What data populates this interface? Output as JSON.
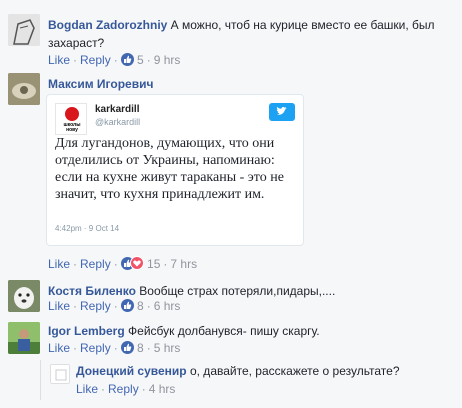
{
  "comments": [
    {
      "author": "Bogdan Zadorozhniy",
      "text_line1": "А можно, чтоб на курице вместо ее башки, был",
      "text_line2": "захараст?",
      "like_label": "Like",
      "reply_label": "Reply",
      "reaction_count": "5",
      "time": "9 hrs",
      "reactions": [
        "like-icon"
      ]
    },
    {
      "author": "Максим Игоревич",
      "like_label": "Like",
      "reply_label": "Reply",
      "reaction_count": "15",
      "time": "7 hrs",
      "reactions": [
        "like-icon",
        "love-icon"
      ],
      "tweet": {
        "logo_label": "школы нову",
        "user": "karkardill",
        "handle": "@karkardill",
        "body": "Для лугандонов, думающих, что они отделились от Украины, напоминаю: если на кухне живут тараканы - это не значит, что кухня принадлежит им.",
        "timestamp": "4:42pm · 9 Oct 14"
      }
    },
    {
      "author": "Костя Биленко",
      "text_line1": "Вообще страх потеряли,пидары,....",
      "like_label": "Like",
      "reply_label": "Reply",
      "reaction_count": "8",
      "time": "6 hrs",
      "reactions": [
        "like-icon"
      ]
    },
    {
      "author": "Igor Lemberg",
      "text_line1": "Фейсбук долбанувся- пишу скаргу.",
      "like_label": "Like",
      "reply_label": "Reply",
      "reaction_count": "8",
      "time": "5 hrs",
      "reactions": [
        "like-icon"
      ]
    },
    {
      "author": "Донецкий сувенир",
      "text_line1": "о, давайте, расскажете о результате?",
      "like_label": "Like",
      "reply_label": "Reply",
      "time": "4 hrs"
    }
  ],
  "colors": {
    "author": "#365899",
    "action_link": "#4267b2",
    "meta": "#90949c",
    "background": "#f6f7f9",
    "like_reaction": "#4267b2",
    "love_reaction": "#f25268",
    "twitter": "#1da1f2"
  }
}
